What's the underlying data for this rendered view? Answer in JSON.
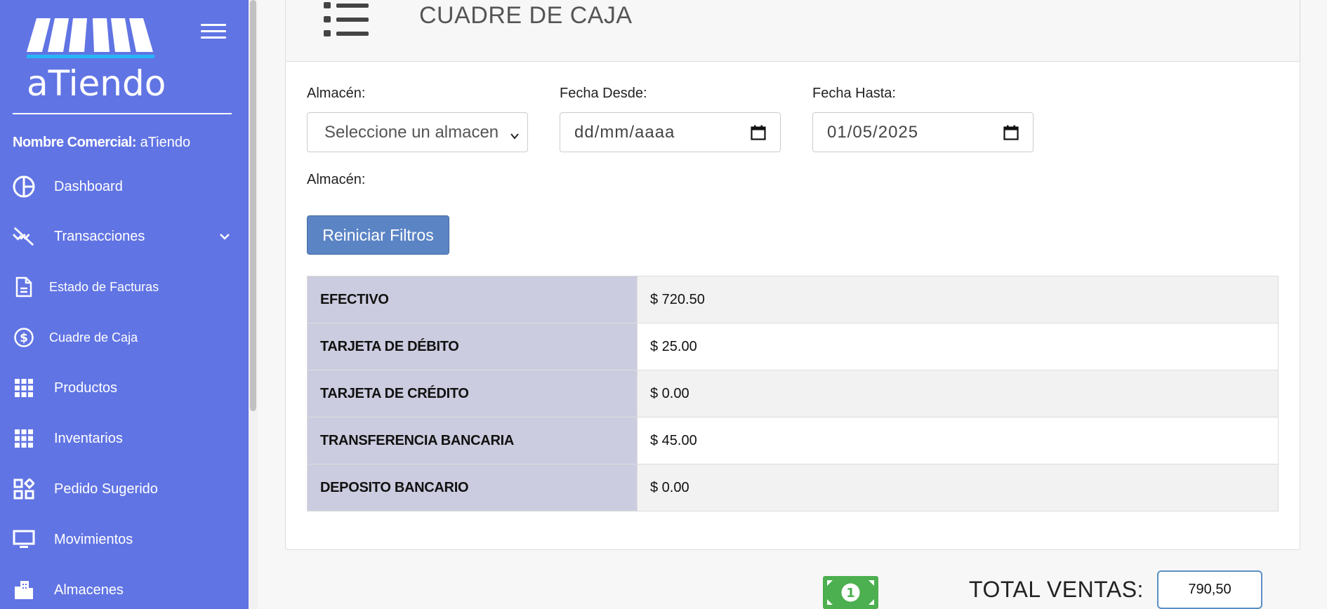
{
  "sidebar": {
    "logo_text": "aTiendo",
    "commercial_label": "Nombre Comercial:",
    "commercial_value": "aTiendo",
    "items": [
      {
        "label": "Dashboard",
        "icon": "pie-chart-icon"
      },
      {
        "label": "Transacciones",
        "icon": "transactions-icon",
        "expandable": true
      },
      {
        "label": "Estado de Facturas",
        "icon": "document-icon"
      },
      {
        "label": "Cuadre de Caja",
        "icon": "dollar-circle-icon"
      },
      {
        "label": "Productos",
        "icon": "grid-icon"
      },
      {
        "label": "Inventarios",
        "icon": "grid-icon"
      },
      {
        "label": "Pedido Sugerido",
        "icon": "widgets-icon"
      },
      {
        "label": "Movimientos",
        "icon": "monitor-icon"
      },
      {
        "label": "Almacenes",
        "icon": "building-icon"
      }
    ]
  },
  "page": {
    "title": "CUADRE DE CAJA"
  },
  "filters": {
    "almacen_label": "Almacén:",
    "almacen_placeholder": "Seleccione un almacen",
    "desde_label": "Fecha Desde:",
    "desde_value": "dd/mm/aaaa",
    "hasta_label": "Fecha Hasta:",
    "hasta_value": "01/05/2025",
    "almacen_selected_label": "Almacén:",
    "reset_label": "Reiniciar Filtros"
  },
  "payments": [
    {
      "method": "EFECTIVO",
      "amount": "$ 720.50"
    },
    {
      "method": "TARJETA DE DÉBITO",
      "amount": "$ 25.00"
    },
    {
      "method": "TARJETA DE CRÉDITO",
      "amount": "$ 0.00"
    },
    {
      "method": "TRANSFERENCIA BANCARIA",
      "amount": "$ 45.00"
    },
    {
      "method": "DEPOSITO BANCARIO",
      "amount": "$ 0.00"
    }
  ],
  "totals": {
    "label": "TOTAL VENTAS:",
    "value": "790,50"
  },
  "colors": {
    "sidebar_bg": "#6174e4",
    "button_bg": "#5b84c4",
    "table_key_bg": "#cccce0",
    "money_green": "#4caf50"
  }
}
